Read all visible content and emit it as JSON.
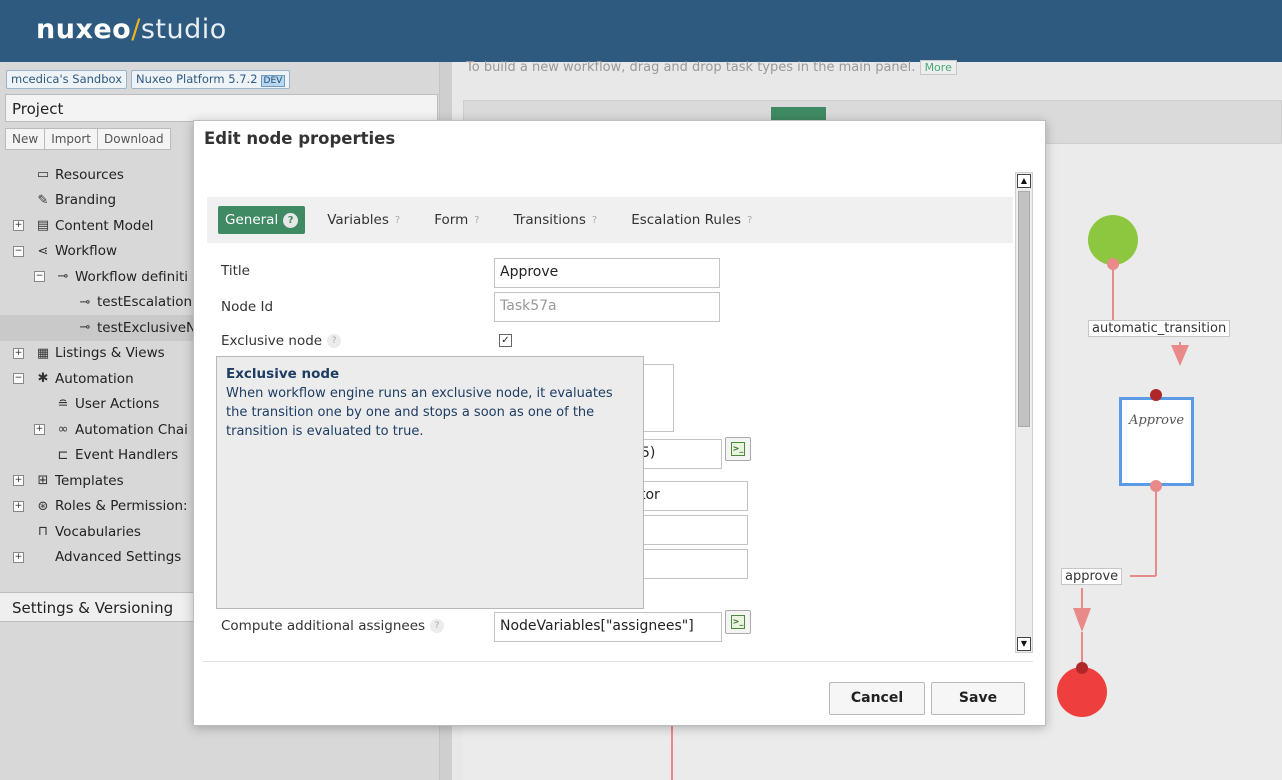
{
  "header": {
    "logo_brand": "nuxeo",
    "logo_slash": "/",
    "logo_product": "studio"
  },
  "sandbox": {
    "name": "mcedica's Sandbox",
    "platform": "Nuxeo Platform 5.7.2",
    "badge": "DEV"
  },
  "project": {
    "title": "Project",
    "toolbar": [
      "New",
      "Import",
      "Download"
    ],
    "tree": [
      {
        "label": "Resources",
        "icon": "resources-icon",
        "glyph": "▭"
      },
      {
        "label": "Branding",
        "icon": "branding-icon",
        "glyph": "✎"
      },
      {
        "label": "Content Model",
        "icon": "content-model-icon",
        "glyph": "▤"
      },
      {
        "label": "Workflow",
        "icon": "workflow-icon",
        "glyph": "⋖"
      },
      {
        "label": "Workflow definiti",
        "icon": "workflow-definition-icon",
        "glyph": "⊸"
      },
      {
        "label": "testEscalation",
        "icon": "workflow-item-icon",
        "glyph": "⊸"
      },
      {
        "label": "testExclusiveN",
        "icon": "workflow-item-icon",
        "glyph": "⊸"
      },
      {
        "label": "Listings & Views",
        "icon": "listings-icon",
        "glyph": "▦"
      },
      {
        "label": "Automation",
        "icon": "automation-icon",
        "glyph": "✱"
      },
      {
        "label": "User Actions",
        "icon": "user-actions-icon",
        "glyph": "≘"
      },
      {
        "label": "Automation Chai",
        "icon": "automation-chain-icon",
        "glyph": "∞"
      },
      {
        "label": "Event Handlers",
        "icon": "event-handlers-icon",
        "glyph": "⊏"
      },
      {
        "label": "Templates",
        "icon": "templates-icon",
        "glyph": "⊞"
      },
      {
        "label": "Roles & Permission:",
        "icon": "roles-icon",
        "glyph": "⊛"
      },
      {
        "label": "Vocabularies",
        "icon": "vocabularies-icon",
        "glyph": "⊓"
      },
      {
        "label": "Advanced Settings",
        "icon": "",
        "glyph": ""
      }
    ],
    "settings_title": "Settings & Versioning"
  },
  "main": {
    "hint_text": "To build a new workflow, drag and drop task types in the main panel.",
    "hint_more": "More"
  },
  "diagram": {
    "label_automatic": "automatic_transition",
    "node_approve": "Approve",
    "label_approve": "approve",
    "colors": {
      "start": "#8dc63f",
      "end": "#ee3e3e",
      "edge": "#e98a8a",
      "node_border": "#5b9be6"
    }
  },
  "modal": {
    "title": "Edit node properties",
    "tabs": [
      "General",
      "Variables",
      "Form",
      "Transitions",
      "Escalation Rules"
    ],
    "help_mark": "?",
    "fields": {
      "title_label": "Title",
      "title_value": "Approve",
      "nodeid_label": "Node Id",
      "nodeid_value": "Task57a",
      "exclusive_label": "Exclusive node",
      "exclusive_check": "✓",
      "partial_1": "5)",
      "partial_2": "tor",
      "assignees_label": "Compute additional assignees",
      "assignees_value": "NodeVariables[\"assignees\"]"
    },
    "tooltip": {
      "title": "Exclusive node",
      "text": "When workflow engine runs an exclusive node, it evaluates the transition one by one and stops a soon as one of the transition is evaluated to true."
    },
    "cancel_label": "Cancel",
    "save_label": "Save"
  }
}
